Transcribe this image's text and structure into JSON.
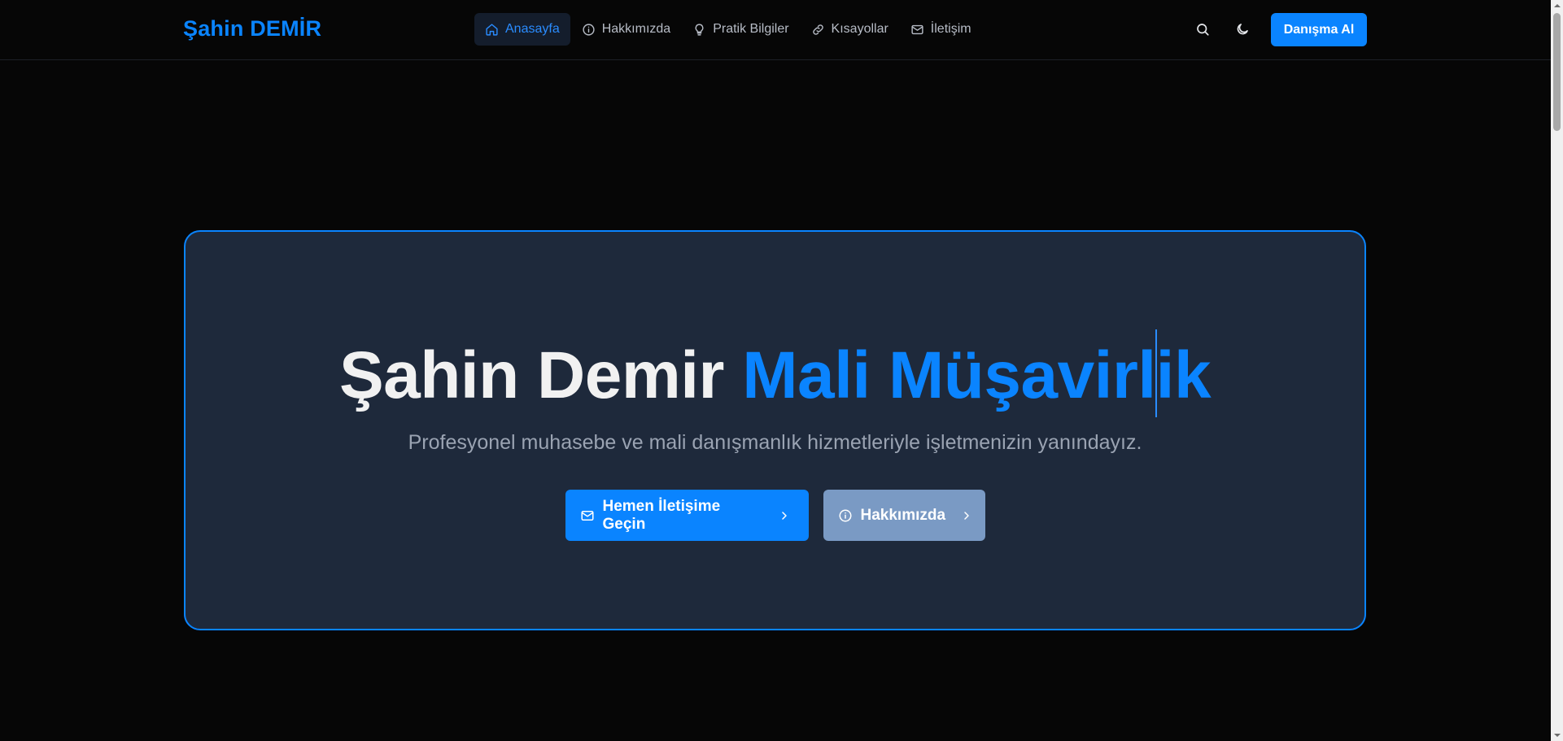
{
  "header": {
    "brand": "Şahin DEMİR",
    "nav": [
      {
        "label": "Anasayfa",
        "icon": "home-icon",
        "active": true
      },
      {
        "label": "Hakkımızda",
        "icon": "info-icon",
        "active": false
      },
      {
        "label": "Pratik Bilgiler",
        "icon": "lightbulb-icon",
        "active": false
      },
      {
        "label": "Kısayollar",
        "icon": "link-icon",
        "active": false
      },
      {
        "label": "İletişim",
        "icon": "mail-icon",
        "active": false
      }
    ],
    "cta_label": "Danışma Al",
    "search_icon": "search-icon",
    "theme_icon": "moon-icon"
  },
  "hero": {
    "title_white": "Şahin Demir ",
    "title_blue_before_caret": "Mali Müşavirl",
    "title_blue_after_caret": "ik",
    "subtitle": "Profesyonel muhasebe ve mali danışmanlık hizmetleriyle işletmenizin yanındayız.",
    "primary_button": "Hemen İletişime Geçin",
    "secondary_button": "Hakkımızda"
  },
  "colors": {
    "background": "#060606",
    "accent": "#0a84ff",
    "card": "#1e293b",
    "secondary_button": "#7a9ac4"
  }
}
